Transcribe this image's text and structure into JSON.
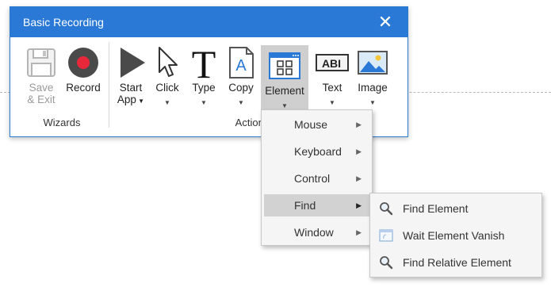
{
  "window": {
    "title": "Basic Recording",
    "close_icon": "close-icon"
  },
  "ribbon": {
    "groups": [
      {
        "label": "Wizards"
      },
      {
        "label": "Actions"
      }
    ],
    "buttons": [
      {
        "id": "save-exit",
        "label_line1": "Save",
        "label_line2": "& Exit",
        "icon": "floppy-disk-icon",
        "enabled": false
      },
      {
        "id": "record",
        "label": "Record",
        "icon": "record-icon",
        "enabled": true
      },
      {
        "id": "start-app",
        "label_line1": "Start",
        "label_line2": "App",
        "icon": "play-icon",
        "has_dropdown": true
      },
      {
        "id": "click",
        "label": "Click",
        "icon": "cursor-arrow-icon",
        "has_dropdown": true
      },
      {
        "id": "type",
        "label": "Type",
        "icon": "type-t-icon",
        "has_dropdown": true
      },
      {
        "id": "copy",
        "label": "Copy",
        "icon": "copy-document-icon",
        "has_dropdown": true
      },
      {
        "id": "element",
        "label": "Element",
        "icon": "element-window-icon",
        "has_dropdown": true,
        "active": true
      },
      {
        "id": "text",
        "label": "Text",
        "icon": "text-abi-icon",
        "has_dropdown": true
      },
      {
        "id": "image",
        "label": "Image",
        "icon": "image-icon",
        "has_dropdown": true
      }
    ]
  },
  "element_menu": {
    "items": [
      {
        "label": "Mouse",
        "has_submenu": true
      },
      {
        "label": "Keyboard",
        "has_submenu": true
      },
      {
        "label": "Control",
        "has_submenu": true
      },
      {
        "label": "Find",
        "has_submenu": true,
        "highlighted": true
      },
      {
        "label": "Window",
        "has_submenu": true
      }
    ]
  },
  "find_submenu": {
    "items": [
      {
        "label": "Find Element",
        "icon": "magnifier-icon"
      },
      {
        "label": "Wait Element Vanish",
        "icon": "window-vanish-icon"
      },
      {
        "label": "Find Relative Element",
        "icon": "magnifier-icon"
      }
    ]
  },
  "colors": {
    "titlebar": "#2b79d6",
    "record_red": "#e8283a",
    "active_button_bg": "#cfcfcf",
    "menu_bg": "#f5f5f5",
    "menu_highlight": "#d2d2d2"
  }
}
